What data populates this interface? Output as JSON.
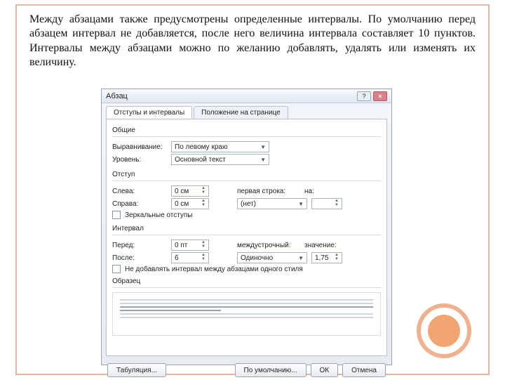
{
  "paragraph": "Между абзацами также предусмотрены определенные интервалы. По умолчанию перед абзацем интервал не добавляется, после него величина интервала составляет 10 пунктов. Интервалы между абзацами можно по желанию добавлять, удалять или изменять их величину.",
  "dialog": {
    "title": "Абзац",
    "tabs": [
      "Отступы и интервалы",
      "Положение на странице"
    ],
    "groups": {
      "general": {
        "title": "Общие",
        "align_label": "Выравнивание:",
        "align_value": "По левому краю",
        "level_label": "Уровень:",
        "level_value": "Основной текст"
      },
      "indent": {
        "title": "Отступ",
        "left_label": "Слева:",
        "left_value": "0 см",
        "right_label": "Справа:",
        "right_value": "0 см",
        "first_label": "первая строка:",
        "first_value": "(нет)",
        "by_label": "на:",
        "by_value": "",
        "mirror": "Зеркальные отступы"
      },
      "spacing": {
        "title": "Интервал",
        "before_label": "Перед:",
        "before_value": "0 пт",
        "after_label": "После:",
        "after_value": "6",
        "line_label": "междустрочный:",
        "line_value": "Одиночно",
        "mult_label": "значение:",
        "mult_value": "1,75",
        "no_space": "Не добавлять интервал между абзацами одного стиля"
      },
      "sample": "Образец"
    },
    "buttons": {
      "tabs_btn": "Табуляция...",
      "default_btn": "По умолчанию...",
      "ok": "ОК",
      "cancel": "Отмена"
    }
  }
}
